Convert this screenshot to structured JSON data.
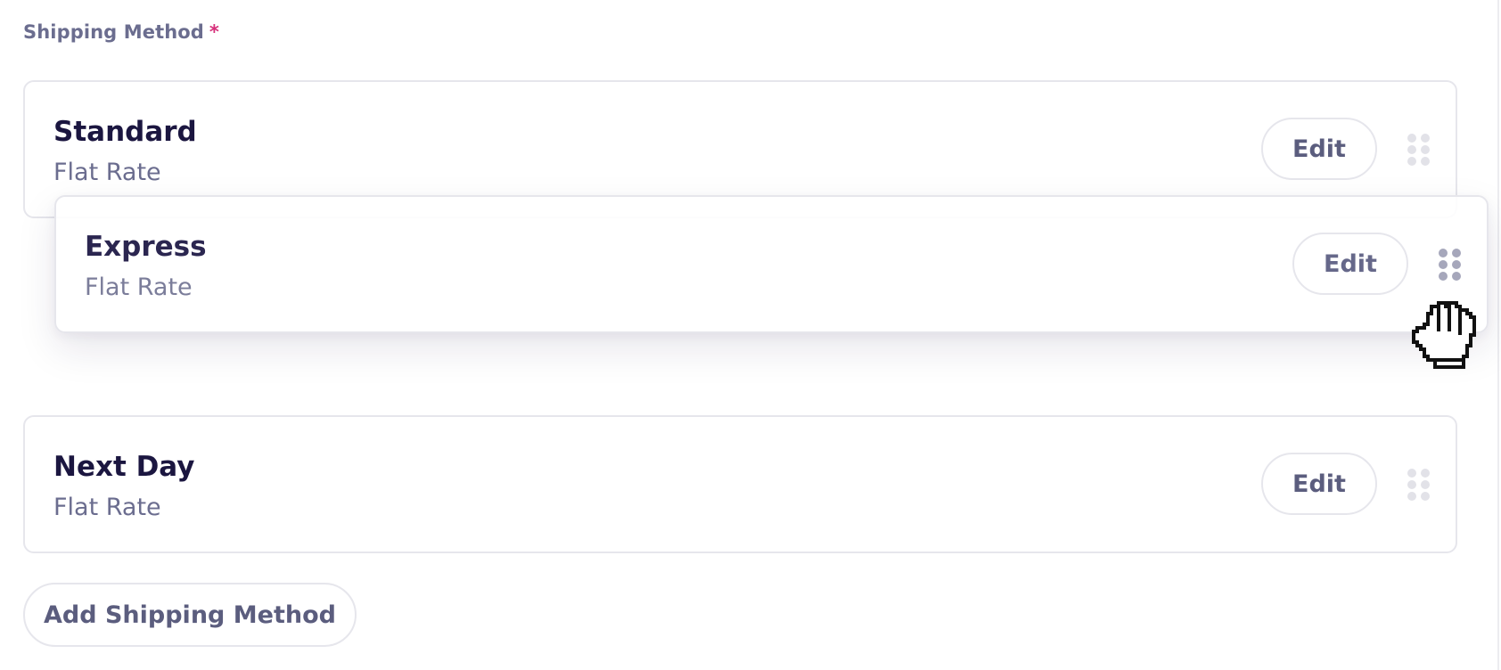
{
  "field": {
    "label": "Shipping Method",
    "required_mark": "*"
  },
  "methods": [
    {
      "name": "Standard",
      "type": "Flat Rate",
      "edit_label": "Edit",
      "state": "static"
    },
    {
      "name": "Express",
      "type": "Flat Rate",
      "edit_label": "Edit",
      "state": "dragging"
    },
    {
      "name": "Next Day",
      "type": "Flat Rate",
      "edit_label": "Edit",
      "state": "static"
    }
  ],
  "add_button": {
    "label": "Add Shipping Method"
  },
  "icons": {
    "drag_handle": "drag-handle-icon",
    "cursor": "grab-hand-cursor-icon"
  },
  "colors": {
    "title": "#1b1640",
    "muted": "#6b6d8f",
    "required": "#d6307a",
    "border": "#e6e6ec"
  }
}
